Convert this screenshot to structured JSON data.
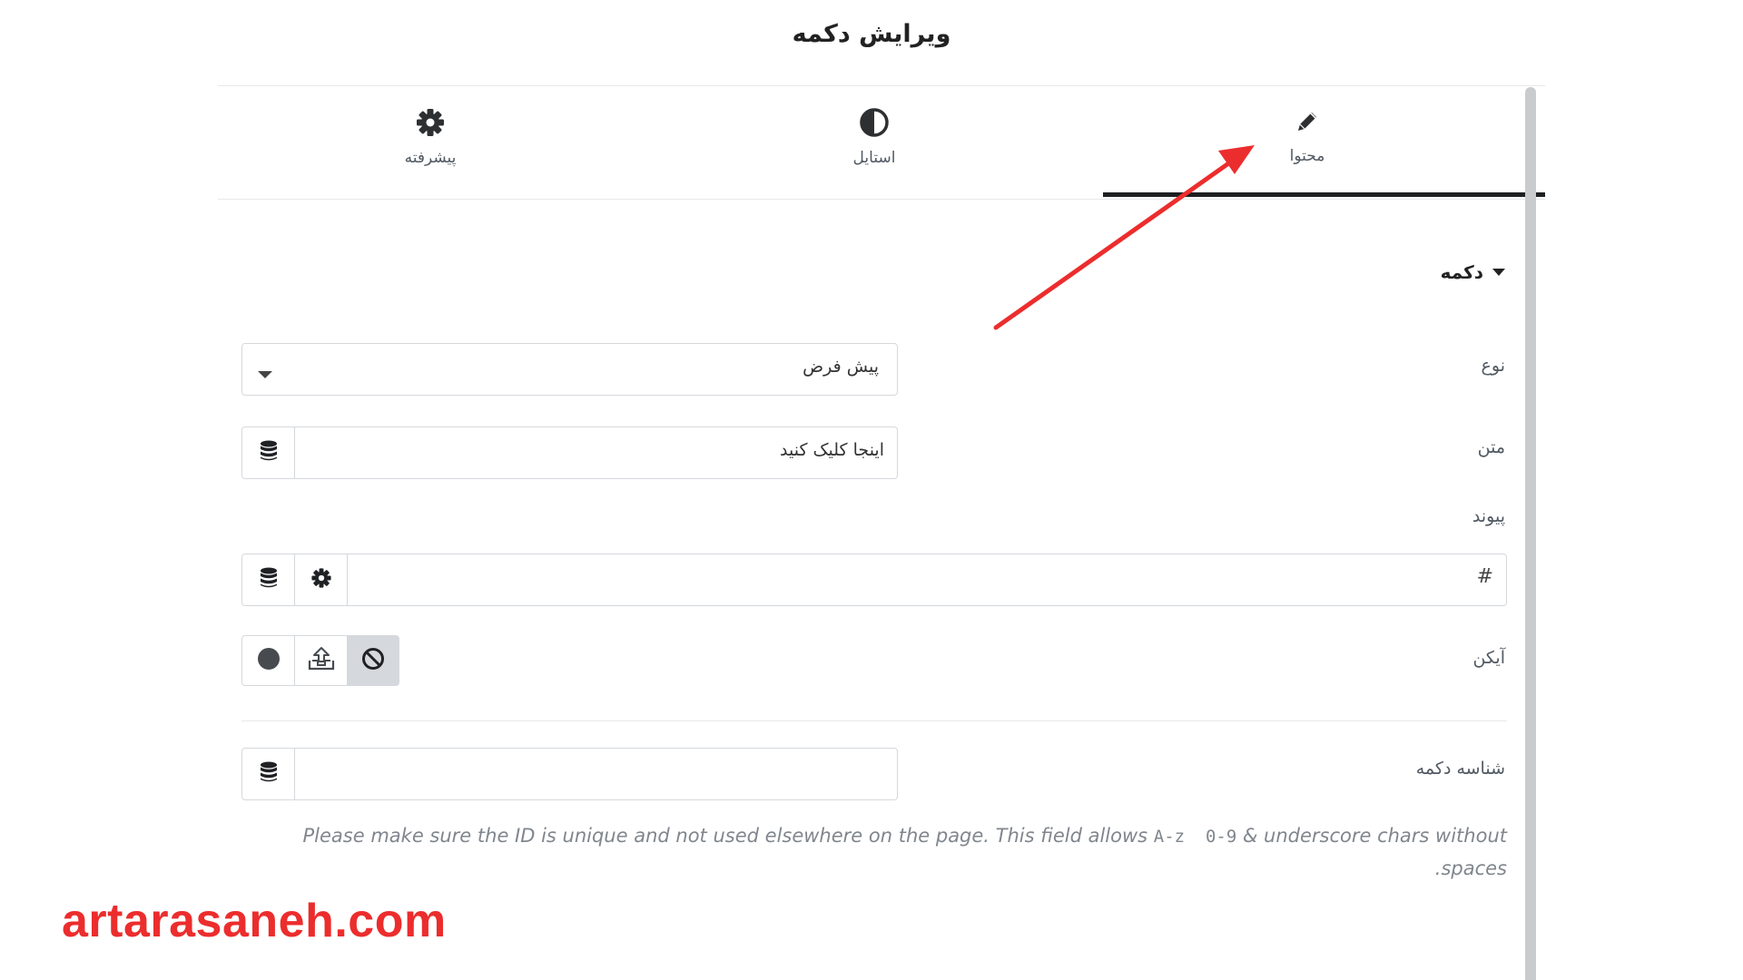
{
  "header": {
    "title": "ویرایش دکمه"
  },
  "tabs": [
    {
      "label": "محتوا",
      "icon": "pencil-icon",
      "active": true
    },
    {
      "label": "استایل",
      "icon": "half-circle-icon",
      "active": false
    },
    {
      "label": "پیشرفته",
      "icon": "gear-icon",
      "active": false
    }
  ],
  "section": {
    "title": "دکمه"
  },
  "fields": {
    "type": {
      "label": "نوع",
      "value": "پیش فرض"
    },
    "text": {
      "label": "متن",
      "value": "اینجا کلیک کنید"
    },
    "link": {
      "label": "پیوند",
      "value": "#"
    },
    "icon": {
      "label": "آیکن",
      "selected": "none"
    },
    "button_id": {
      "label": "شناسه دکمه",
      "value": ""
    }
  },
  "help": {
    "part1": "Please make sure the ID is unique and not used elsewhere on the page. This field allows ",
    "code": "A-z  0-9",
    "part2": " & underscore chars without spaces."
  },
  "watermark": {
    "text": "artarasaneh.com"
  },
  "colors": {
    "accent_arrow": "#ec2d2d",
    "tab_underline": "#1d1f21",
    "border": "#d5d8dc",
    "selected_choice_bg": "#d5d8dc"
  }
}
